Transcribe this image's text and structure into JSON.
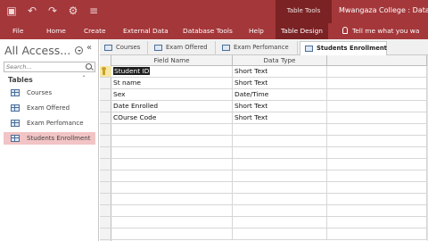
{
  "window": {
    "quick_access": [
      "save-icon",
      "undo-icon",
      "redo-icon",
      "touch-mode-icon",
      "customize-icon"
    ],
    "context_tools_label": "Table Tools",
    "document_title": "Mwangaza College : Datab"
  },
  "ribbon": {
    "tabs": [
      "File",
      "Home",
      "Create",
      "External Data",
      "Database Tools",
      "Help",
      "Table Design"
    ],
    "active_tab": "Table Design",
    "tell_me": "Tell me what you wa"
  },
  "nav_pane": {
    "title": "All Access...",
    "search_placeholder": "Search...",
    "group_label": "Tables",
    "items": [
      "Courses",
      "Exam Offered",
      "Exam Perfomance",
      "Students Enrollment"
    ],
    "selected_item": "Students Enrollment"
  },
  "doc_tabs": [
    "Courses",
    "Exam Offered",
    "Exam Perfomance",
    "Students Enrollment"
  ],
  "active_doc_tab": "Students Enrollment",
  "design_grid": {
    "columns": [
      "Field Name",
      "Data Type"
    ],
    "rows": [
      {
        "field": "Student ID",
        "type": "Short Text",
        "primary_key": true
      },
      {
        "field": "St name",
        "type": "Short Text"
      },
      {
        "field": "Sex",
        "type": "Date/Time"
      },
      {
        "field": "Date Enrolled",
        "type": "Short Text"
      },
      {
        "field": "COurse Code",
        "type": "Short Text"
      }
    ]
  },
  "colors": {
    "title_bar": "#a4373a",
    "context_tab": "#7a2224",
    "selected_nav_item": "#f2c4c5"
  }
}
